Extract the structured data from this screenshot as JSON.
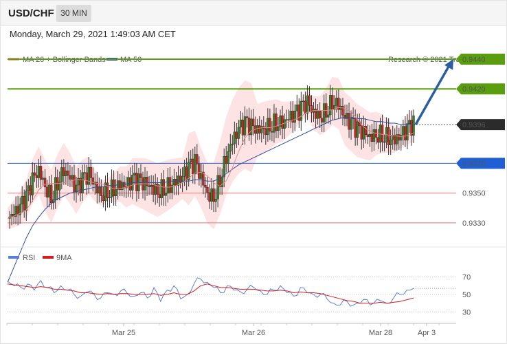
{
  "header": {
    "symbol": "USD/CHF",
    "interval": "30 MIN"
  },
  "datetime": "Monday, March 29, 2021 1:49:03 AM CET",
  "copyright": "Research © 2021 Trading Central",
  "colors": {
    "green": "#5a9e0f",
    "blue": "#1f5fd6",
    "red_line": "#f0a0a0",
    "bb_fill": "#fcd9d9",
    "candle": "#333333",
    "ma50": "#2c4f9c",
    "arrow": "#2b5ea0"
  },
  "chart_data": [
    {
      "type": "line",
      "legend": [
        "MA 20 + Bollinger Bands",
        "MA 50"
      ],
      "x_ticks": [
        "Mar 25",
        "Mar 26",
        "Mar 28",
        "Apr 3"
      ],
      "ylim": [
        0.9305,
        0.9452
      ],
      "price_levels": [
        {
          "value": 0.944,
          "label": "0.9440",
          "style": "green"
        },
        {
          "value": 0.942,
          "label": "0.9420",
          "style": "green"
        },
        {
          "value": 0.9396,
          "label": "0.9396",
          "style": "current"
        },
        {
          "value": 0.937,
          "label": "0.9370",
          "style": "blue"
        },
        {
          "value": 0.935,
          "label": "0.9350",
          "style": "red"
        },
        {
          "value": 0.933,
          "label": "0.9330",
          "style": "red"
        }
      ],
      "arrow": {
        "from": 0.9396,
        "to": 0.944
      },
      "price_path": [
        0.9333,
        0.9336,
        0.934,
        0.9346,
        0.9358,
        0.9365,
        0.9355,
        0.9348,
        0.9358,
        0.9366,
        0.936,
        0.9352,
        0.9358,
        0.9362,
        0.9355,
        0.935,
        0.9352,
        0.9354,
        0.9356,
        0.9354,
        0.9358,
        0.9357,
        0.9356,
        0.9354,
        0.9352,
        0.9354,
        0.9356,
        0.9358,
        0.936,
        0.9366,
        0.937,
        0.936,
        0.935,
        0.9348,
        0.936,
        0.9375,
        0.9385,
        0.9392,
        0.9396,
        0.9394,
        0.9392,
        0.9394,
        0.9396,
        0.9398,
        0.9398,
        0.94,
        0.9402,
        0.9406,
        0.941,
        0.9404,
        0.9402,
        0.9406,
        0.9412,
        0.941,
        0.94,
        0.9396,
        0.9392,
        0.939,
        0.9388,
        0.939,
        0.939,
        0.9388,
        0.9386,
        0.9388,
        0.9392,
        0.9396
      ],
      "ma50_path": [
        0.929,
        0.93,
        0.931,
        0.932,
        0.9328,
        0.9334,
        0.9339,
        0.9343,
        0.9346,
        0.9348,
        0.935,
        0.9351,
        0.9352,
        0.9353,
        0.9354,
        0.9354,
        0.9355,
        0.9355,
        0.9356,
        0.9356,
        0.9357,
        0.9357,
        0.9357,
        0.9357,
        0.9357,
        0.9357,
        0.9358,
        0.9358,
        0.9358,
        0.9358,
        0.9359,
        0.9359,
        0.9358,
        0.9358,
        0.936,
        0.9363,
        0.9366,
        0.9369,
        0.9371,
        0.9373,
        0.9375,
        0.9377,
        0.9379,
        0.9381,
        0.9383,
        0.9385,
        0.9387,
        0.9389,
        0.9391,
        0.9393,
        0.9395,
        0.9397,
        0.9399,
        0.94,
        0.9401,
        0.9401,
        0.94,
        0.94,
        0.9399,
        0.9398,
        0.9398,
        0.9397,
        0.9397,
        0.9396,
        0.9396,
        0.9396
      ]
    },
    {
      "type": "line",
      "legend": [
        "RSI",
        "9MA"
      ],
      "yticks": [
        70,
        50,
        30
      ],
      "ylim": [
        20,
        80
      ],
      "rsi": [
        65,
        60,
        58,
        62,
        55,
        66,
        58,
        52,
        60,
        55,
        50,
        48,
        53,
        50,
        46,
        52,
        50,
        54,
        51,
        48,
        52,
        46,
        58,
        42,
        55,
        60,
        45,
        50,
        62,
        68,
        64,
        58,
        52,
        60,
        55,
        53,
        56,
        58,
        54,
        50,
        55,
        60,
        52,
        48,
        58,
        52,
        50,
        50,
        45,
        40,
        38,
        42,
        38,
        40,
        44,
        40,
        43,
        40,
        46,
        50,
        55,
        57
      ],
      "ma9": [
        62,
        61,
        60,
        59,
        58,
        59,
        58,
        56,
        56,
        55,
        54,
        52,
        52,
        51,
        50,
        51,
        50,
        51,
        51,
        50,
        50,
        50,
        51,
        49,
        50,
        52,
        50,
        50,
        54,
        60,
        62,
        60,
        58,
        58,
        57,
        56,
        56,
        56,
        55,
        54,
        54,
        55,
        54,
        52,
        53,
        52,
        52,
        51,
        49,
        47,
        45,
        43,
        42,
        40,
        40,
        40,
        41,
        40,
        41,
        42,
        44,
        46
      ]
    }
  ]
}
